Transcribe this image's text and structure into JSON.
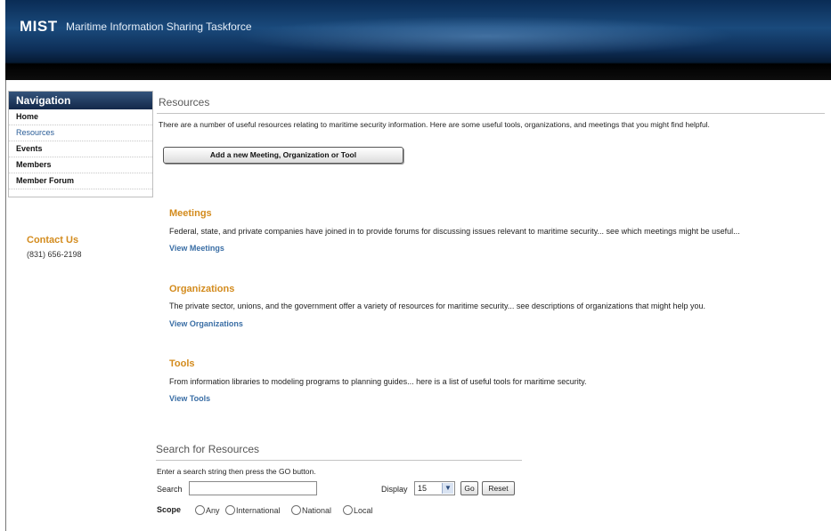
{
  "header": {
    "logo": "MIST",
    "tagline": "Maritime Information Sharing Taskforce"
  },
  "navigation": {
    "title": "Navigation",
    "items": [
      {
        "label": "Home",
        "active": false
      },
      {
        "label": "Resources",
        "active": true
      },
      {
        "label": "Events",
        "active": false
      },
      {
        "label": "Members",
        "active": false
      },
      {
        "label": "Member Forum",
        "active": false
      }
    ]
  },
  "contact": {
    "title": "Contact Us",
    "phone": "(831) 656-2198"
  },
  "main": {
    "title": "Resources",
    "intro": "There are a number of useful resources relating to maritime security information. Here are some useful tools, organizations, and meetings that you might find helpful.",
    "add_button": "Add a new Meeting, Organization or Tool",
    "sections": [
      {
        "title": "Meetings",
        "description": "Federal, state, and private companies have joined in to provide forums for discussing issues relevant to maritime security... see which meetings might be useful...",
        "link": "View Meetings"
      },
      {
        "title": "Organizations",
        "description": "The private sector, unions, and the government offer a variety of resources for maritime security... see descriptions of organizations that might help you.",
        "link": "View Organizations"
      },
      {
        "title": "Tools",
        "description": "From information libraries to modeling programs to planning guides... here is a list of useful tools for maritime security.",
        "link": "View Tools"
      }
    ]
  },
  "search": {
    "title": "Search for Resources",
    "hint": "Enter a search string then press the GO button.",
    "label": "Search",
    "value": "",
    "display_label": "Display",
    "display_value": "15",
    "go_label": "Go",
    "reset_label": "Reset",
    "scope_label": "Scope",
    "scope_options": [
      "Any",
      "International",
      "National",
      "Local"
    ]
  },
  "colors": {
    "accent": "#d38b1d",
    "link": "#3a6ea5",
    "banner": "#0e2f58"
  }
}
